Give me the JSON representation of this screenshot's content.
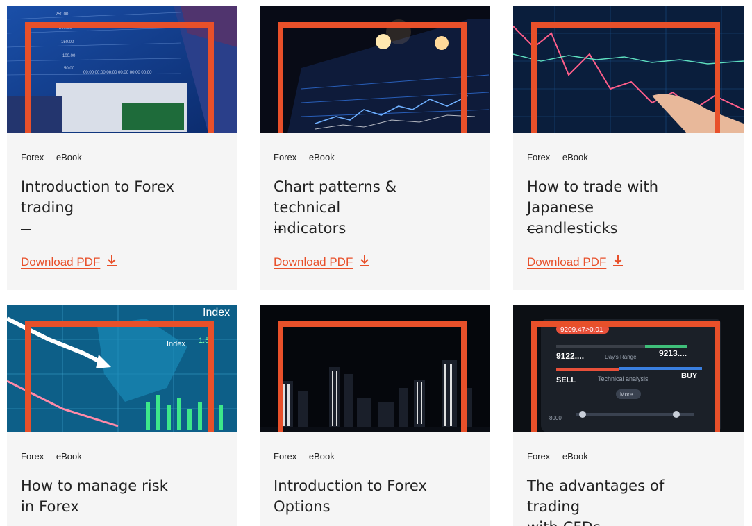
{
  "cards": [
    {
      "tags": [
        "Forex",
        "eBook"
      ],
      "title_line1": "Introduction to Forex",
      "title_line2": "trading",
      "dash": "–",
      "download_label": "Download PDF",
      "image": "forex-trading-screen-image"
    },
    {
      "tags": [
        "Forex",
        "eBook"
      ],
      "title_line1": "Chart patterns & technical",
      "title_line2": "indicators",
      "dash": "–",
      "download_label": "Download PDF",
      "image": "chart-on-tablet-image"
    },
    {
      "tags": [
        "Forex",
        "eBook"
      ],
      "title_line1": "How to trade with Japanese",
      "title_line2": "candlesticks",
      "dash": "–",
      "download_label": "Download PDF",
      "image": "candlestick-chart-finger-image"
    },
    {
      "tags": [
        "Forex",
        "eBook"
      ],
      "title_line1": "How to manage risk",
      "title_line2": "in Forex",
      "image": "index-world-map-chart-image",
      "overlay_texts": [
        "Index",
        "Index",
        "1.56"
      ]
    },
    {
      "tags": [
        "Forex",
        "eBook"
      ],
      "title_line1": "Introduction to Forex",
      "title_line2": "Options",
      "image": "city-skyline-night-image"
    },
    {
      "tags": [
        "Forex",
        "eBook"
      ],
      "title_line1": "The advantages of trading",
      "title_line2": "with CFDs",
      "image": "trading-app-phone-image",
      "overlay_texts": [
        "9209.47>0.01",
        "9122....",
        "Day's Range",
        "9213....",
        "SELL",
        "Technical analysis",
        "BUY",
        "More",
        "8000"
      ]
    }
  ],
  "colors": {
    "accent": "#e8502a",
    "card_bg": "#f5f5f5",
    "text": "#222222"
  },
  "icons": {
    "download": "download-arrow-icon"
  }
}
